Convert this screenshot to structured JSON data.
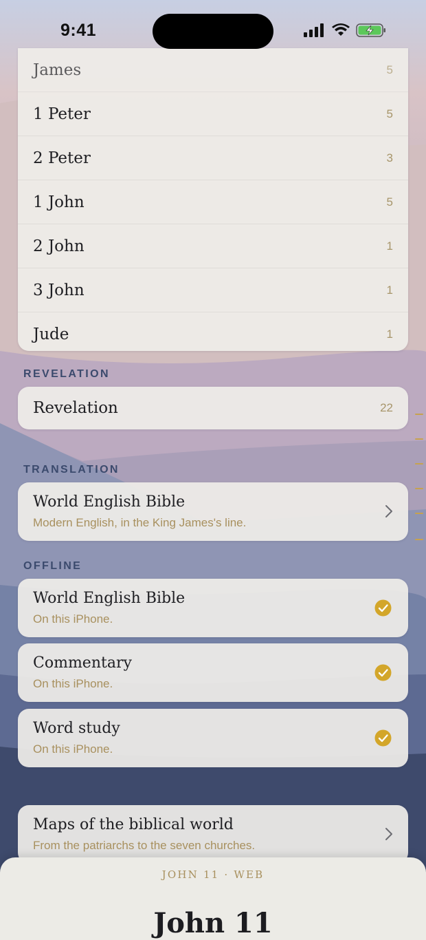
{
  "status_bar": {
    "time": "9:41"
  },
  "nt_books": [
    {
      "name": "James",
      "chapters": "5"
    },
    {
      "name": "1 Peter",
      "chapters": "5"
    },
    {
      "name": "2 Peter",
      "chapters": "3"
    },
    {
      "name": "1 John",
      "chapters": "5"
    },
    {
      "name": "2 John",
      "chapters": "1"
    },
    {
      "name": "3 John",
      "chapters": "1"
    },
    {
      "name": "Jude",
      "chapters": "1"
    }
  ],
  "revelation_section": {
    "label": "REVELATION",
    "book": {
      "name": "Revelation",
      "chapters": "22"
    }
  },
  "translation_section": {
    "label": "TRANSLATION",
    "title": "World English Bible",
    "subtitle": "Modern English, in the King James's line."
  },
  "offline_section": {
    "label": "OFFLINE",
    "items": [
      {
        "title": "World English Bible",
        "subtitle": "On this iPhone."
      },
      {
        "title": "Commentary",
        "subtitle": "On this iPhone."
      },
      {
        "title": "Word study",
        "subtitle": "On this iPhone."
      }
    ]
  },
  "maps": {
    "title": "Maps of the biblical world",
    "subtitle": "From the patriarchs to the seven churches."
  },
  "reader_sheet": {
    "reference": "JOHN 11 · WEB",
    "title": "John 11"
  },
  "colors": {
    "accent_gold": "#d3a62a",
    "label_blue": "#3b4a6d",
    "muted_gold": "#a8905e"
  },
  "icons": [
    "signal-icon",
    "wifi-icon",
    "battery-charging-icon",
    "chevron-right-icon",
    "checkmark-circle-icon"
  ]
}
